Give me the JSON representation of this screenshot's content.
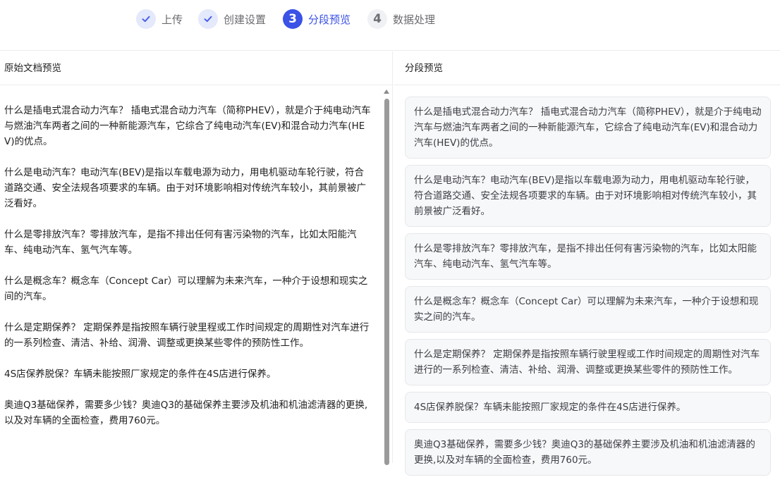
{
  "steps": [
    {
      "label": "上传",
      "state": "done",
      "icon": "check-icon"
    },
    {
      "label": "创建设置",
      "state": "done",
      "icon": "check-icon"
    },
    {
      "label": "分段预览",
      "state": "active",
      "number": "3"
    },
    {
      "label": "数据处理",
      "state": "pending",
      "number": "4"
    }
  ],
  "left_panel": {
    "title": "原始文档预览",
    "paragraphs": [
      "什么是插电式混合动力汽车？ 插电式混合动力汽车（简称PHEV），就是介于纯电动汽车与燃油汽车两者之间的一种新能源汽车，它综合了纯电动汽车(EV)和混合动力汽车(HEV)的优点。",
      "什么是电动汽车？电动汽车(BEV)是指以车载电源为动力，用电机驱动车轮行驶，符合道路交通、安全法规各项要求的车辆。由于对环境影响相对传统汽车较小，其前景被广泛看好。",
      "什么是零排放汽车？零排放汽车，是指不排出任何有害污染物的汽车，比如太阳能汽车、纯电动汽车、氢气汽车等。",
      "什么是概念车？概念车（Concept Car）可以理解为未来汽车，一种介于设想和现实之间的汽车。",
      "什么是定期保养？ 定期保养是指按照车辆行驶里程或工作时间规定的周期性对汽车进行的一系列检查、清洁、补给、润滑、调整或更换某些零件的预防性工作。",
      "4S店保养脱保？车辆未能按照厂家规定的条件在4S店进行保养。",
      "奥迪Q3基础保养，需要多少钱？奥迪Q3的基础保养主要涉及机油和机油滤清器的更换,以及对车辆的全面检查，费用760元。"
    ]
  },
  "right_panel": {
    "title": "分段预览",
    "chunks": [
      "什么是插电式混合动力汽车？ 插电式混合动力汽车（简称PHEV），就是介于纯电动汽车与燃油汽车两者之间的一种新能源汽车，它综合了纯电动汽车(EV)和混合动力汽车(HEV)的优点。",
      "什么是电动汽车？电动汽车(BEV)是指以车载电源为动力，用电机驱动车轮行驶，符合道路交通、安全法规各项要求的车辆。由于对环境影响相对传统汽车较小，其前景被广泛看好。",
      "什么是零排放汽车？零排放汽车，是指不排出任何有害污染物的汽车，比如太阳能汽车、纯电动汽车、氢气汽车等。",
      "什么是概念车？概念车（Concept Car）可以理解为未来汽车，一种介于设想和现实之间的汽车。",
      "什么是定期保养？ 定期保养是指按照车辆行驶里程或工作时间规定的周期性对汽车进行的一系列检查、清洁、补给、润滑、调整或更换某些零件的预防性工作。",
      "4S店保养脱保？车辆未能按照厂家规定的条件在4S店进行保养。",
      "奥迪Q3基础保养，需要多少钱？奥迪Q3的基础保养主要涉及机油和机油滤清器的更换,以及对车辆的全面检查，费用760元。"
    ]
  },
  "colors": {
    "accent": "#3b52e6",
    "done_bg": "#e4e9fb",
    "chunk_bg": "#f7f8fa",
    "border": "#ececec"
  }
}
